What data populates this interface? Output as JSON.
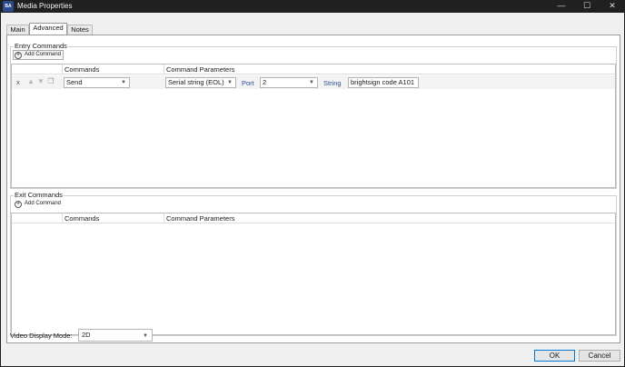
{
  "window": {
    "title": "Media Properties",
    "app_icon_text": "BA",
    "minimize_glyph": "—",
    "maximize_glyph": "☐",
    "close_glyph": "✕"
  },
  "tabs": [
    {
      "label": "Main",
      "active": false
    },
    {
      "label": "Advanced",
      "active": true
    },
    {
      "label": "Notes",
      "active": false
    }
  ],
  "entry_commands": {
    "legend": "Entry Commands",
    "add_label": "Add Command",
    "columns": [
      "Commands",
      "Command Parameters"
    ],
    "rows": [
      {
        "remove": "x",
        "command": "Send",
        "type": "Serial string (EOL)",
        "port_label": "Port",
        "port": "2",
        "string_label": "String",
        "string_value": "brightsign code A101"
      }
    ]
  },
  "exit_commands": {
    "legend": "Exit Commands",
    "add_label": "Add Command",
    "columns": [
      "Commands",
      "Command Parameters"
    ],
    "rows": []
  },
  "video_display_mode": {
    "label": "Video Display Mode:",
    "value": "2D"
  },
  "buttons": {
    "ok": "OK",
    "cancel": "Cancel"
  },
  "colors": {
    "accent": "#0078d7",
    "link_label": "#2d4f8f"
  }
}
